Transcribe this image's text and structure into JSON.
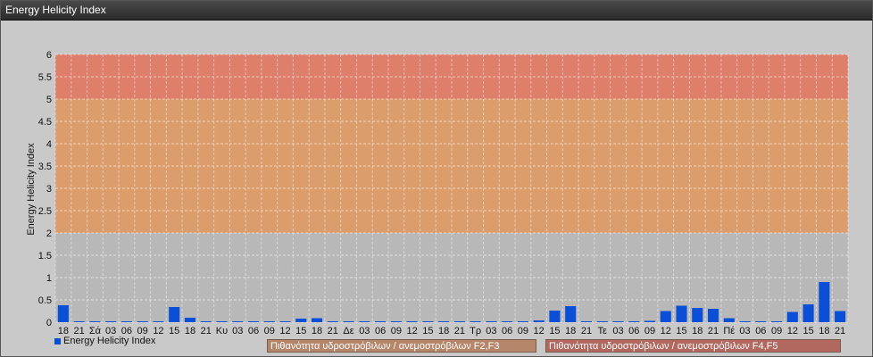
{
  "window": {
    "title": "Energy Helicity Index"
  },
  "colors": {
    "bar": "#0a4fd8",
    "band_low": "#b8b8b8",
    "band_mid": "#dc9d6c",
    "band_high": "#de7f6c",
    "note1": "#b6866a",
    "note2": "#b2685f"
  },
  "notes": [
    {
      "label": "Πιθανότητα υδροστρόβιλων / ανεμοστρόβιλων F2,F3"
    },
    {
      "label": "Πιθανότητα υδροστρόβιλων / ανεμοστρόβιλων F4,F5"
    }
  ],
  "chart_data": {
    "type": "bar",
    "title": "",
    "ylabel": "Energy Helicity Index",
    "xlabel": "",
    "ylim": [
      0,
      6
    ],
    "yticks": [
      "0",
      "0.5",
      "1",
      "1.5",
      "2",
      "2.5",
      "3",
      "3.5",
      "4",
      "4.5",
      "5",
      "5.5",
      "6"
    ],
    "grid": true,
    "legend_position": "bottom-left",
    "bands": [
      {
        "from": 0,
        "to": 2,
        "level": "low"
      },
      {
        "from": 2,
        "to": 5,
        "level": "mid"
      },
      {
        "from": 5,
        "to": 6,
        "level": "high"
      }
    ],
    "categories": [
      "18",
      "21",
      "Σά",
      "03",
      "06",
      "09",
      "12",
      "15",
      "18",
      "21",
      "Κυ",
      "03",
      "06",
      "09",
      "12",
      "15",
      "18",
      "21",
      "Δε",
      "03",
      "06",
      "09",
      "12",
      "15",
      "18",
      "21",
      "Τρ",
      "03",
      "06",
      "09",
      "12",
      "15",
      "18",
      "21",
      "Τε",
      "03",
      "06",
      "09",
      "12",
      "15",
      "18",
      "21",
      "Πέ",
      "03",
      "06",
      "09",
      "12",
      "15",
      "18",
      "21"
    ],
    "series": [
      {
        "name": "Energy Helicity Index",
        "values": [
          0.38,
          0.02,
          0.02,
          0.02,
          0.02,
          0.02,
          0.02,
          0.34,
          0.1,
          0.01,
          0.01,
          0.01,
          0.01,
          0.01,
          0.01,
          0.08,
          0.09,
          0.01,
          0.01,
          0.01,
          0.01,
          0.01,
          0.01,
          0.01,
          0.01,
          0.01,
          0.01,
          0.01,
          0.01,
          0.01,
          0.04,
          0.26,
          0.36,
          0.01,
          0.01,
          0.01,
          0.01,
          0.03,
          0.25,
          0.37,
          0.32,
          0.3,
          0.09,
          0.01,
          0.01,
          0.01,
          0.23,
          0.4,
          0.9,
          0.25
        ]
      }
    ]
  }
}
